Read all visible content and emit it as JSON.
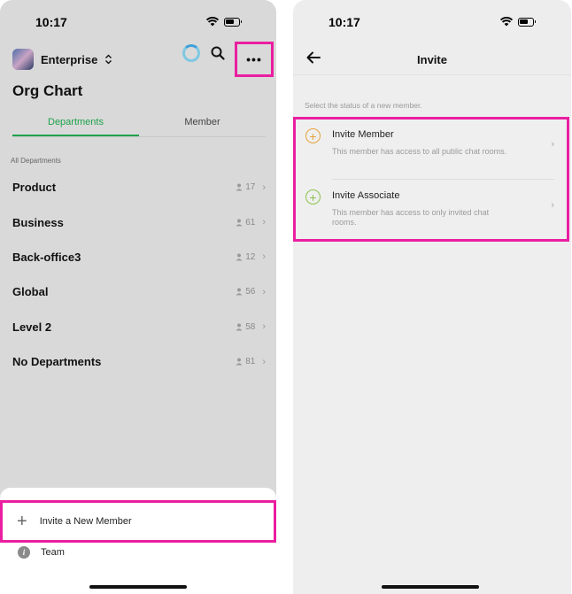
{
  "colors": {
    "highlight": "#ea1ea0",
    "active_tab": "#1fa24a",
    "member_icon": "#e6a23c",
    "associate_icon": "#8bc34a"
  },
  "left": {
    "status_time": "10:17",
    "workspace_name": "Enterprise",
    "workspace_chevron": "⌃⌄",
    "more_label": "•••",
    "page_title": "Org Chart",
    "tabs": [
      {
        "label": "Departments",
        "active": true
      },
      {
        "label": "Member",
        "active": false
      }
    ],
    "section_label": "All Departments",
    "departments": [
      {
        "name": "Product",
        "count": "17"
      },
      {
        "name": "Business",
        "count": "61"
      },
      {
        "name": "Back-office3",
        "count": "12"
      },
      {
        "name": "Global",
        "count": "56"
      },
      {
        "name": "Level 2",
        "count": "58"
      },
      {
        "name": "No Departments",
        "count": "81"
      }
    ],
    "sheet": {
      "invite_label": "Invite a New Member",
      "team_label": "Team",
      "info_glyph": "i",
      "plus_glyph": "+"
    }
  },
  "right": {
    "status_time": "10:17",
    "nav_title": "Invite",
    "hint": "Select the status of a new member.",
    "options": [
      {
        "title": "Invite Member",
        "description": "This member has access to all public chat rooms.",
        "icon": "plus-circle-icon"
      },
      {
        "title": "Invite Associate",
        "description": "This member has access to only invited chat rooms.",
        "icon": "plus-circle-icon"
      }
    ]
  }
}
